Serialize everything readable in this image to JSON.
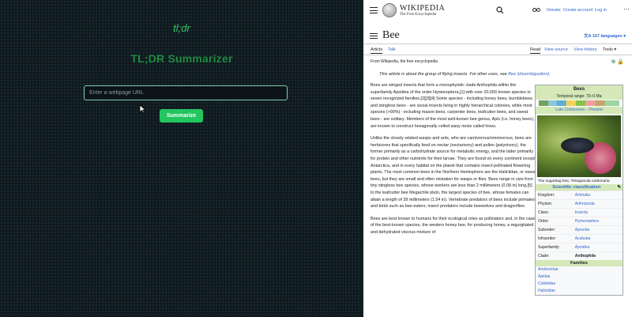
{
  "left_app": {
    "logo": "tl;dr",
    "title": "TL;DR Summarizer",
    "url_placeholder": "Enter a webpage URL",
    "submit_label": "Summarize"
  },
  "wiki": {
    "wordmark": "WIKIPEDIA",
    "tagline": "The Free Encyclopedia",
    "header_links": [
      "Donate",
      "Create account",
      "Log in"
    ],
    "page_title": "Bee",
    "languages": "157 languages",
    "tabs": [
      "Article",
      "Talk"
    ],
    "right_tabs": [
      "Read",
      "View source",
      "View history",
      "Tools"
    ],
    "from_line": "From Wikipedia, the free encyclopedia",
    "hatnote_prefix": "This article is about the group of flying insects. For other uses, see",
    "hatnote_link": "Bee (disambiguation).",
    "paragraphs": [
      "Bees are winged insects that form a monophyletic clade Anthophila within the superfamily Apoidea of the order Hymenoptera,[1] with over 20,000 known species in seven recognized families.[2][3][4] Some species - including honey bees, bumblebees, and stingless bees - are social insects living in highly hierarchical colonies, while most species (>90%) - including mason bees, carpenter bees, leafcutter bees, and sweat bees - are solitary. Members of the most well-known bee genus, Apis (i.e. honey bees), are known to construct hexagonally celled waxy nests called hives.",
      "Unlike the closely related wasps and ants, who are carnivorous/omnivorous, bees are herbivores that specifically feed on nectar (nectarivory) and pollen (palynivory), the former primarily as a carbohydrate source for metabolic energy, and the latter primarily for protein and other nutrients for their larvae. They are found on every continent except Antarctica, and in every habitat on the planet that contains insect-pollinated flowering plants. The most common bees in the Northern Hemisphere are the Halictidae, or sweat bees, but they are small and often mistaken for wasps or flies. Bees range in size from tiny stingless bee species, whose workers are less than 2 millimeters (0.08 in) long,[5] to the leafcutter bee Megachile pluto, the largest species of bee, whose females can attain a length of 39 millimeters (1.54 in). Vertebrate predators of bees include primates and birds such as bee-eaters; insect predators include beewolves and dragonflies.",
      "Bees are best known to humans for their ecological roles as pollinators and, in the case of the best-known species, the western honey bee, for producing honey, a regurgitated and dehydrated viscous mixture of"
    ],
    "infobox": {
      "title": "Bees",
      "range_label": "Temporal range: 70–0 Ma",
      "range_sub": "Late Cretaceous – Present",
      "caption": "The sugarbag bee, Tetragonula carbonaria",
      "classification_head": "Scientific classification",
      "rows": [
        {
          "k": "Kingdom:",
          "v": "Animalia"
        },
        {
          "k": "Phylum:",
          "v": "Arthropoda"
        },
        {
          "k": "Class:",
          "v": "Insecta"
        },
        {
          "k": "Order:",
          "v": "Hymenoptera"
        },
        {
          "k": "Suborder:",
          "v": "Apocrita"
        },
        {
          "k": "Infraorder:",
          "v": "Aculeata"
        },
        {
          "k": "Superfamily:",
          "v": "Apoidea"
        },
        {
          "k": "Clade:",
          "v": "Anthophila"
        }
      ],
      "families_head": "Families",
      "families": [
        "Andrenidae",
        "Apidae",
        "Colletidae",
        "Halictidae"
      ]
    }
  }
}
